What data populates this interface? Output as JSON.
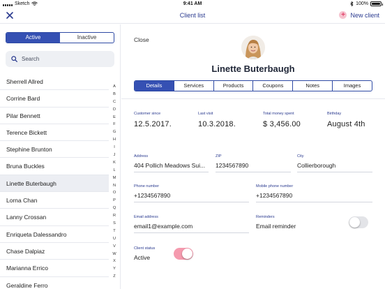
{
  "statusbar": {
    "carrier": "Sketch",
    "time": "9:41 AM",
    "battery": "100%",
    "battery_level": 1.0
  },
  "navbar": {
    "title": "Client list",
    "new_client_label": "New client",
    "new_client_icon": "plus-circle-icon",
    "close_icon": "close-icon"
  },
  "sidebar": {
    "segment": {
      "active_label": "Active",
      "inactive_label": "Inactive",
      "selected": "Active"
    },
    "search": {
      "placeholder": "Search"
    },
    "clients": [
      "Sherrell Allred",
      "Corrine Bard",
      "Pilar Bennett",
      "Terence Bickett",
      "Stephine Brunton",
      "Bruna Buckles",
      "Linette Buterbaugh",
      "Lorna Chan",
      "Lanny Crossan",
      "Enriqueta Dalessandro",
      "Chase Dalpiaz",
      "Marianna Errico",
      "Geraldine Ferro"
    ],
    "selected_client": "Linette Buterbaugh",
    "alphabet": [
      "A",
      "B",
      "C",
      "D",
      "E",
      "F",
      "G",
      "H",
      "I",
      "J",
      "K",
      "L",
      "M",
      "N",
      "O",
      "P",
      "Q",
      "R",
      "S",
      "T",
      "U",
      "V",
      "W",
      "X",
      "Y",
      "Z"
    ]
  },
  "detail": {
    "close_label": "Close",
    "name": "Linette Buterbaugh",
    "tabs": [
      "Details",
      "Services",
      "Products",
      "Coupons",
      "Notes",
      "Images"
    ],
    "active_tab": "Details",
    "stats": {
      "customer_since_label": "Customer since",
      "customer_since": "12.5.2017.",
      "last_visit_label": "Last visit",
      "last_visit": "10.3.2018.",
      "total_spent_label": "Total money spent",
      "total_spent": "$ 3,456.00",
      "birthday_label": "Birthday",
      "birthday": "August 4th"
    },
    "fields": {
      "address_label": "Address",
      "address": "404 Pollich Meadows Sui...",
      "zip_label": "ZIP",
      "zip": "1234567890",
      "city_label": "City",
      "city": "Collierborough",
      "phone_label": "Phone number",
      "phone": "+1234567890",
      "mobile_label": "Mobile phone number",
      "mobile": "+1234567890",
      "email_label": "Email address",
      "email": "email1@example.com",
      "reminders_label": "Reminders",
      "reminders": "Email reminder",
      "reminders_on": false,
      "status_label": "Client status",
      "status": "Active",
      "status_on": true
    }
  },
  "colors": {
    "accent": "#3550b3",
    "label": "#2a3a8f",
    "pink": "#f59aae",
    "pink_icon": "#e2426a"
  }
}
